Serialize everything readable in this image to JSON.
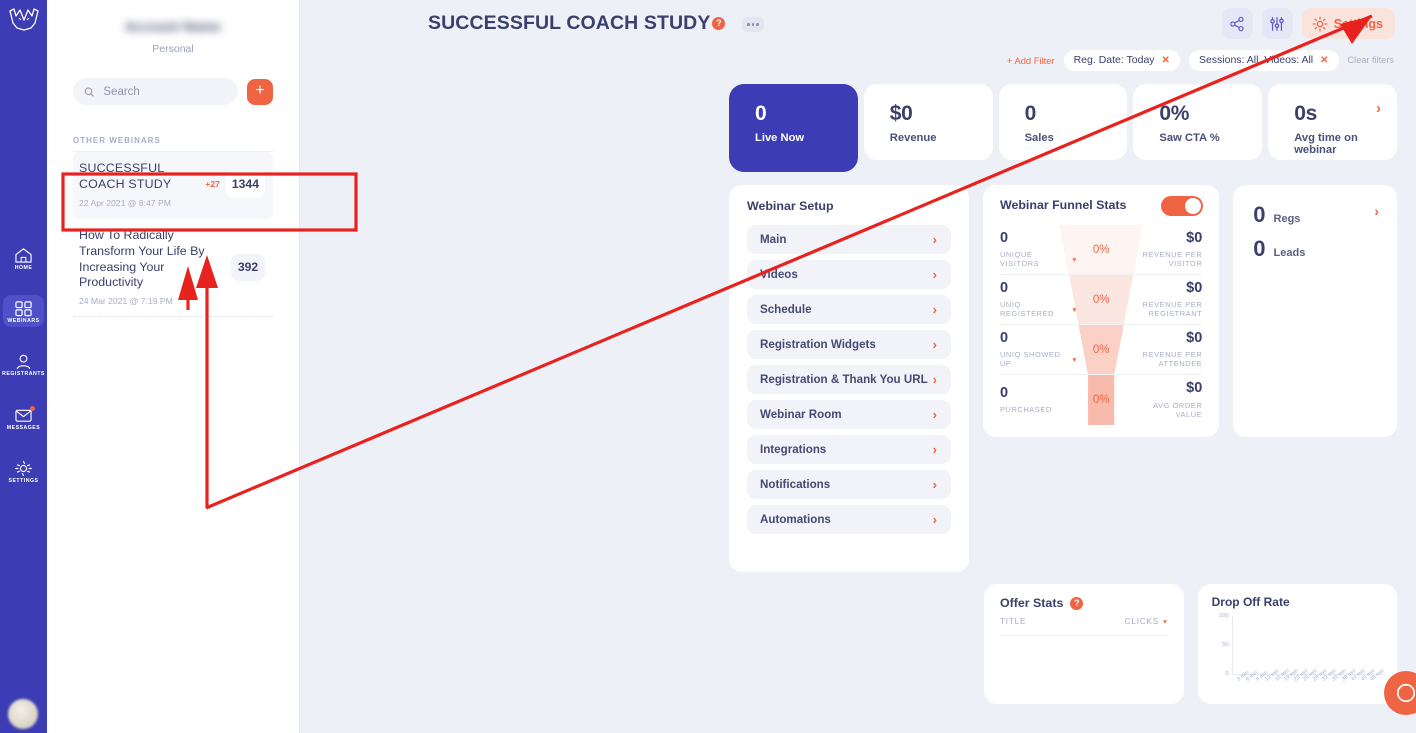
{
  "brand": {
    "primary": "#3c3cb4",
    "accent": "#ef6544",
    "text": "#3a406b",
    "muted": "#a7adc4"
  },
  "rail": {
    "items": [
      {
        "label": "HOME",
        "icon": "home-icon",
        "active": false,
        "badge": false
      },
      {
        "label": "WEBINARS",
        "icon": "grid-icon",
        "active": true,
        "badge": false
      },
      {
        "label": "REGISTRANTS",
        "icon": "user-icon",
        "active": false,
        "badge": false
      },
      {
        "label": "MESSAGES",
        "icon": "envelope-icon",
        "active": false,
        "badge": true
      },
      {
        "label": "SETTINGS",
        "icon": "gear-icon",
        "active": false,
        "badge": false
      }
    ]
  },
  "sidebar": {
    "account_name": "",
    "account_type": "Personal",
    "search_placeholder": "Search",
    "search_value": "",
    "add_label": "+",
    "section_label": "OTHER WEBINARS",
    "webinars": [
      {
        "title": "SUCCESSFUL COACH STUDY",
        "date": "22 Apr 2021 @ 8:47 PM",
        "delta": "+27",
        "count": "1344",
        "selected": true
      },
      {
        "title": "How To Radically Transform Your Life By Increasing Your Productivity",
        "date": "24 Mar 2021 @ 7:19 PM",
        "delta": "",
        "count": "392",
        "selected": false
      }
    ]
  },
  "header": {
    "title": "SUCCESSFUL COACH STUDY",
    "help_glyph": "?",
    "share_icon": "share-icon",
    "filters_icon": "sliders-icon",
    "settings_label": "Settings"
  },
  "filters": {
    "add_label": "+ Add Filter",
    "chips": [
      {
        "label": "Reg. Date: Today",
        "remove": "✕"
      },
      {
        "label": "Sessions: All, Videos: All",
        "remove": "✕"
      }
    ],
    "clear_label": "Clear filters"
  },
  "kpis": [
    {
      "value": "0",
      "label": "Live Now",
      "primary": true,
      "arrow": false
    },
    {
      "value": "$0",
      "label": "Revenue",
      "primary": false,
      "arrow": false
    },
    {
      "value": "0",
      "label": "Sales",
      "primary": false,
      "arrow": false
    },
    {
      "value": "0%",
      "label": "Saw CTA %",
      "primary": false,
      "arrow": false
    },
    {
      "value": "0s",
      "label": "Avg time on webinar",
      "primary": false,
      "arrow": true
    }
  ],
  "setup": {
    "title": "Webinar Setup",
    "items": [
      {
        "label": "Main"
      },
      {
        "label": "Videos"
      },
      {
        "label": "Schedule"
      },
      {
        "label": "Registration Widgets"
      },
      {
        "label": "Registration & Thank You URL"
      },
      {
        "label": "Webinar Room"
      },
      {
        "label": "Integrations"
      },
      {
        "label": "Notifications"
      },
      {
        "label": "Automations"
      }
    ]
  },
  "funnel": {
    "title": "Webinar Funnel Stats",
    "toggle_on": true,
    "rows": [
      {
        "count": "0",
        "caption": "UNIQUE VISITORS",
        "has_caret": true,
        "percent": "0%",
        "money": "$0",
        "money_caption": "REVENUE PER VISITOR"
      },
      {
        "count": "0",
        "caption": "UNIQ REGISTERED",
        "has_caret": true,
        "percent": "0%",
        "money": "$0",
        "money_caption": "REVENUE PER REGISTRANT"
      },
      {
        "count": "0",
        "caption": "UNIQ SHOWED UP",
        "has_caret": true,
        "percent": "0%",
        "money": "$0",
        "money_caption": "REVENUE PER ATTENDEE"
      },
      {
        "count": "0",
        "caption": "PURCHASED",
        "has_caret": false,
        "percent": "0%",
        "money": "$0",
        "money_caption": "AVG ORDER VALUE"
      }
    ]
  },
  "regs_panel": {
    "rows": [
      {
        "value": "0",
        "label": "Regs"
      },
      {
        "value": "0",
        "label": "Leads"
      }
    ]
  },
  "offer_stats": {
    "title": "Offer Stats",
    "help_glyph": "?",
    "col_title": "TITLE",
    "col_clicks": "CLICKS",
    "rows": []
  },
  "chart_data": {
    "type": "line",
    "title": "Drop Off Rate",
    "xlabel": "",
    "ylabel": "",
    "ylim": [
      0,
      100
    ],
    "yticks": [
      0,
      50,
      100
    ],
    "ytick_labels": [
      "0",
      "50",
      "100"
    ],
    "grid": false,
    "legend": "none",
    "categories": [
      "3 min",
      "6 min",
      "9 min",
      "12 min",
      "16 min",
      "19 min",
      "22 min",
      "25 min",
      "28 min",
      "32 min",
      "35 min",
      "38 min",
      "41 min",
      "45 min",
      "48 min"
    ],
    "series": [
      {
        "name": "Drop Off Rate",
        "values": [
          null,
          null,
          null,
          null,
          null,
          null,
          null,
          null,
          null,
          null,
          null,
          null,
          null,
          null,
          null
        ]
      }
    ]
  },
  "fab": {
    "icon": "chat-icon"
  }
}
